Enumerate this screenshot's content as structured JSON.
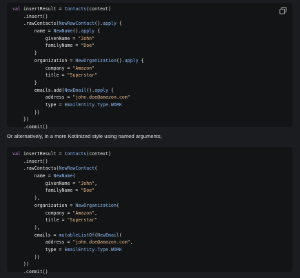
{
  "icons": {
    "copy": "copy-icon"
  },
  "colors": {
    "page_bg": "#1b1c1f",
    "code_bg": "#131415",
    "keyword": "#c87bd6",
    "function": "#8bb8f3",
    "string": "#e7b98a",
    "text": "#e6e6e6"
  },
  "code_blocks": [
    {
      "lines": [
        [
          [
            "kw",
            "val"
          ],
          [
            "p",
            " insertResult = "
          ],
          [
            "fn",
            "Contacts"
          ],
          [
            "p",
            "(context)"
          ]
        ],
        [
          [
            "p",
            "    .insert()"
          ]
        ],
        [
          [
            "p",
            "    .rawContacts("
          ],
          [
            "fn",
            "NewRawContact"
          ],
          [
            "p",
            "()."
          ],
          [
            "fn",
            "apply"
          ],
          [
            "p",
            " {"
          ]
        ],
        [
          [
            "p",
            "        name = "
          ],
          [
            "fn",
            "NewName"
          ],
          [
            "p",
            "()."
          ],
          [
            "fn",
            "apply"
          ],
          [
            "p",
            " {"
          ]
        ],
        [
          [
            "p",
            "            givenName = "
          ],
          [
            "str",
            "\"John\""
          ]
        ],
        [
          [
            "p",
            "            familyName = "
          ],
          [
            "str",
            "\"Doe\""
          ]
        ],
        [
          [
            "p",
            "        }"
          ]
        ],
        [
          [
            "p",
            "        organization = "
          ],
          [
            "fn",
            "NewOrganization"
          ],
          [
            "p",
            "()."
          ],
          [
            "fn",
            "apply"
          ],
          [
            "p",
            " {"
          ]
        ],
        [
          [
            "p",
            "            company = "
          ],
          [
            "str",
            "\"Amazon\""
          ]
        ],
        [
          [
            "p",
            "            title = "
          ],
          [
            "str",
            "\"Superstar\""
          ]
        ],
        [
          [
            "p",
            "        }"
          ]
        ],
        [
          [
            "p",
            "        emails.add("
          ],
          [
            "fn",
            "NewEmail"
          ],
          [
            "p",
            "()."
          ],
          [
            "fn",
            "apply"
          ],
          [
            "p",
            " {"
          ]
        ],
        [
          [
            "p",
            "            address = "
          ],
          [
            "str",
            "\"john.doe@amazon.com\""
          ]
        ],
        [
          [
            "p",
            "            type = "
          ],
          [
            "fn",
            "EmailEntity.Type.WORK"
          ]
        ],
        [
          [
            "p",
            "        })"
          ]
        ],
        [
          [
            "p",
            "    })"
          ]
        ],
        [
          [
            "p",
            "    .commit()"
          ]
        ]
      ]
    },
    {
      "lines": [
        [
          [
            "kw",
            "val"
          ],
          [
            "p",
            " insertResult = "
          ],
          [
            "fn",
            "Contacts"
          ],
          [
            "p",
            "(context)"
          ]
        ],
        [
          [
            "p",
            "    .insert()"
          ]
        ],
        [
          [
            "p",
            "    .rawContacts("
          ],
          [
            "fn",
            "NewRawContact"
          ],
          [
            "p",
            "("
          ]
        ],
        [
          [
            "p",
            "        name = "
          ],
          [
            "fn",
            "NewName"
          ],
          [
            "p",
            "("
          ]
        ],
        [
          [
            "p",
            "            givenName = "
          ],
          [
            "str",
            "\"John\""
          ],
          [
            "p",
            ","
          ]
        ],
        [
          [
            "p",
            "            familyName = "
          ],
          [
            "str",
            "\"Doe\""
          ]
        ],
        [
          [
            "p",
            "        ),"
          ]
        ],
        [
          [
            "p",
            "        organization = "
          ],
          [
            "fn",
            "NewOrganization"
          ],
          [
            "p",
            "("
          ]
        ],
        [
          [
            "p",
            "            company = "
          ],
          [
            "str",
            "\"Amazon\""
          ],
          [
            "p",
            ","
          ]
        ],
        [
          [
            "p",
            "            title = "
          ],
          [
            "str",
            "\"Superstar\""
          ]
        ],
        [
          [
            "p",
            "        ),"
          ]
        ],
        [
          [
            "p",
            "        emails = "
          ],
          [
            "fn",
            "mutableListOf"
          ],
          [
            "p",
            "("
          ],
          [
            "fn",
            "NewEmail"
          ],
          [
            "p",
            "("
          ]
        ],
        [
          [
            "p",
            "            address = "
          ],
          [
            "str",
            "\"john.doe@amazon.com\""
          ],
          [
            "p",
            ","
          ]
        ],
        [
          [
            "p",
            "            type = "
          ],
          [
            "fn",
            "EmailEntity.Type.WORK"
          ]
        ],
        [
          [
            "p",
            "        ))"
          ]
        ],
        [
          [
            "p",
            "    ))"
          ]
        ],
        [
          [
            "p",
            "    .commit()"
          ]
        ]
      ]
    }
  ],
  "prose": {
    "text": "Or alternatively, in a more Kotlinized style using named arguments,"
  }
}
